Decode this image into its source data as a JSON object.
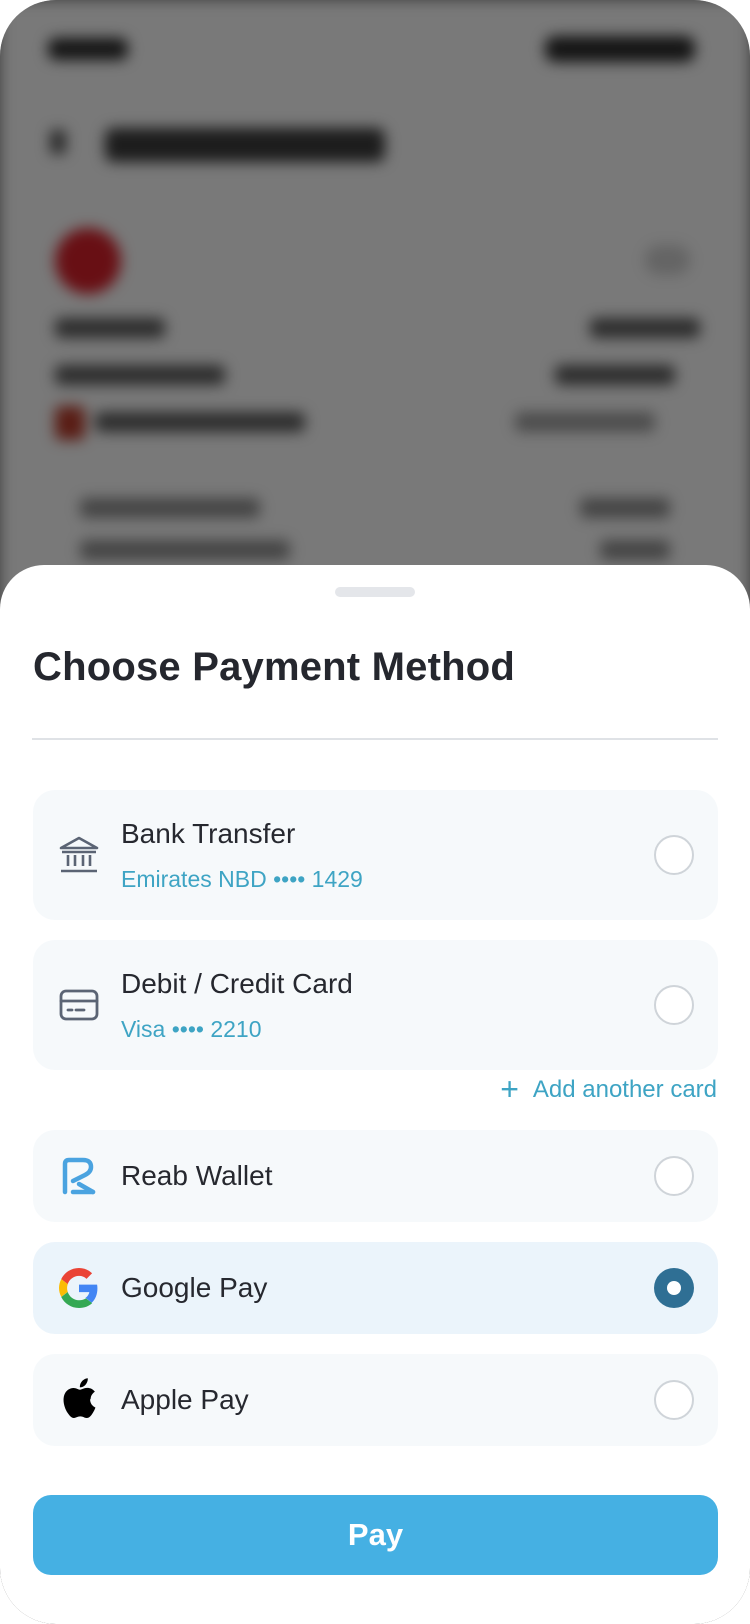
{
  "sheet": {
    "title": "Choose Payment Method",
    "add_card_label": "Add another card",
    "pay_label": "Pay"
  },
  "methods": [
    {
      "label": "Bank Transfer",
      "detail": "Emirates NBD •••• 1429",
      "icon": "bank-icon",
      "selected": false
    },
    {
      "label": "Debit / Credit Card",
      "detail": "Visa •••• 2210",
      "icon": "card-icon",
      "selected": false
    },
    {
      "label": "Reab Wallet",
      "icon": "reab-wallet-icon",
      "selected": false
    },
    {
      "label": "Google Pay",
      "icon": "google-icon",
      "selected": true
    },
    {
      "label": "Apple Pay",
      "icon": "apple-icon",
      "selected": false
    }
  ],
  "colors": {
    "accent": "#45b0e3",
    "link": "#3ea4c4",
    "radio_selected": "#2f6f94",
    "selected_row": "#ebf4fb"
  }
}
